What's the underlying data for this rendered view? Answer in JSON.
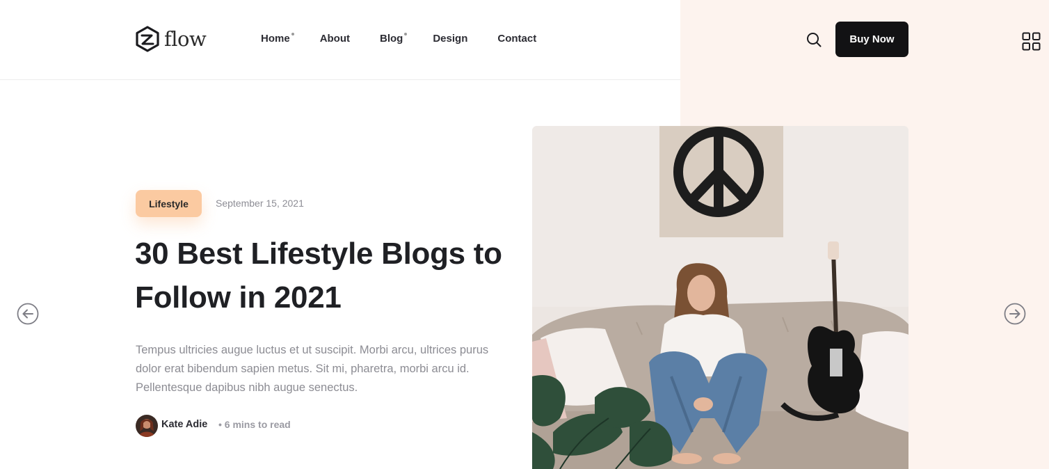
{
  "colors": {
    "accent_peach": "#fbcaa1",
    "panel_background": "#fdf3ee",
    "button_dark": "#121214",
    "heading": "#1f2024",
    "muted_text": "#8c8c93"
  },
  "header": {
    "logo_text": "flow",
    "logo_icon": "hexagon-logo-icon",
    "nav": [
      {
        "label": "Home",
        "has_dropdown_dot": true
      },
      {
        "label": "About",
        "has_dropdown_dot": false
      },
      {
        "label": "Blog",
        "has_dropdown_dot": true
      },
      {
        "label": "Design",
        "has_dropdown_dot": false
      },
      {
        "label": "Contact",
        "has_dropdown_dot": false
      }
    ],
    "search_icon": "search-icon",
    "buy_label": "Buy Now",
    "menu_icon": "grid-menu-icon"
  },
  "slider": {
    "prev_icon": "arrow-left-circle-icon",
    "next_icon": "arrow-right-circle-icon"
  },
  "post": {
    "category": "Lifestyle",
    "date": "September 15, 2021",
    "title": "30 Best Lifestyle Blogs to Follow in 2021",
    "excerpt": "Tempus ultricies augue luctus et ut suscipit. Morbi arcu, ultrices purus dolor erat bibendum sapien metus. Sit mi, pharetra, morbi arcu id. Pellentesque dapibus nibh augue senectus.",
    "author": "Kate Adie",
    "read_time": "• 6 mins to read"
  }
}
